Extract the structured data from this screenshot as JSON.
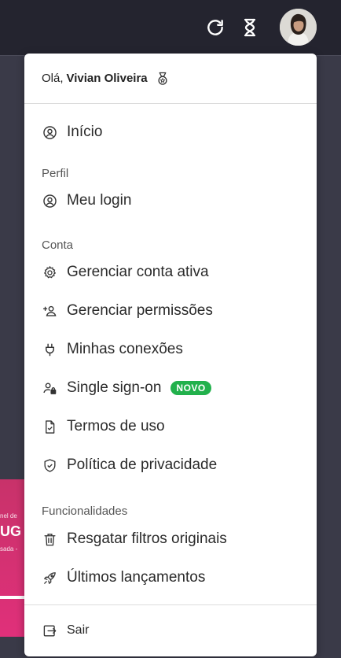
{
  "header": {
    "greeting": "Olá,",
    "user_name": "Vivian Oliveira"
  },
  "menu": {
    "inicio": "Início",
    "perfil_section": "Perfil",
    "meu_login": "Meu login",
    "conta_section": "Conta",
    "gerenciar_conta": "Gerenciar conta ativa",
    "gerenciar_permissoes": "Gerenciar permissões",
    "minhas_conexoes": "Minhas conexões",
    "single_sign_on": "Single sign-on",
    "novo_badge": "NOVO",
    "termos": "Termos de uso",
    "privacidade": "Política de privacidade",
    "funcionalidades_section": "Funcionalidades",
    "resgatar_filtros": "Resgatar filtros originais",
    "ultimos_lancamentos": "Últimos lançamentos",
    "sair": "Sair"
  },
  "background": {
    "banner_line1": "nel de",
    "banner_line2": "UG I",
    "banner_line3": "sada -"
  },
  "colors": {
    "topbar": "#24242f",
    "badge": "#22b14c",
    "banner": "#d8306f"
  },
  "icons": [
    "refresh-icon",
    "hourglass-icon",
    "medal-icon",
    "user-circle-icon",
    "gear-icon",
    "user-plus-icon",
    "plug-icon",
    "user-lock-icon",
    "file-check-icon",
    "shield-check-icon",
    "trash-icon",
    "rocket-icon",
    "logout-icon"
  ]
}
